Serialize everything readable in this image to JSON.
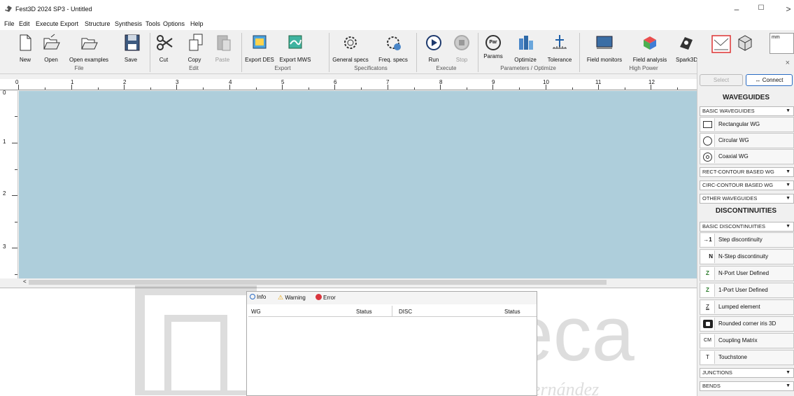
{
  "window": {
    "title": "Fest3D 2024 SP3 - Untitled"
  },
  "menu": [
    "File",
    "Edit",
    "Execute",
    "Export",
    "Structure",
    "Synthesis",
    "Tools",
    "Options",
    "Help"
  ],
  "toolbar": {
    "buttons": [
      {
        "label": "New"
      },
      {
        "label": "Open"
      },
      {
        "label": "Open examples"
      },
      {
        "label": "Save"
      },
      {
        "label": "Cut"
      },
      {
        "label": "Copy"
      },
      {
        "label": "Paste"
      },
      {
        "label": "Export DES"
      },
      {
        "label": "Export MWS"
      },
      {
        "label": "General specs"
      },
      {
        "label": "Freq. specs"
      },
      {
        "label": "Run"
      },
      {
        "label": "Stop"
      },
      {
        "label": "Params"
      },
      {
        "label": "Optimize"
      },
      {
        "label": "Tolerance"
      },
      {
        "label": "Field monitors"
      },
      {
        "label": "Field analysis"
      },
      {
        "label": "Spark3D"
      }
    ],
    "groups": [
      "File",
      "Edit",
      "Export",
      "Specificatons",
      "Execute",
      "Parameters / Optimize",
      "High Power"
    ],
    "params_icon_text": "Par",
    "unit": "mm"
  },
  "ruler": {
    "top": [
      "0",
      "1",
      "2",
      "3",
      "4",
      "5",
      "6",
      "7",
      "8",
      "9",
      "10",
      "11",
      "12"
    ],
    "left": [
      "0",
      "1",
      "2",
      "3"
    ]
  },
  "messages": {
    "tabs": [
      "Info",
      "Warning",
      "Error"
    ],
    "columns": [
      "WG",
      "Status",
      "DISC",
      "Status"
    ]
  },
  "sidepanel": {
    "select_label": "Select",
    "connect_label": "Connect",
    "waveguides_heading": "WAVEGUIDES",
    "discontinuities_heading": "DISCONTINUITIES",
    "cat_basic_wg": "BASIC WAVEGUIDES",
    "wg_items": [
      "Rectangular WG",
      "Circular WG",
      "Coaxial WG"
    ],
    "cat_rect": "RECT-CONTOUR BASED WG",
    "cat_circ": "CIRC-CONTOUR BASED WG",
    "cat_other": "OTHER WAVEGUIDES",
    "cat_basic_disc": "BASIC DISCONTINUITIES",
    "disc_items": [
      "Step discontinuity",
      "N-Step discontinuity",
      "N-Port User Defined",
      "1-Port User Defined",
      "Lumped element",
      "Rounded corner iris 3D",
      "Coupling Matrix",
      "Touchstone"
    ],
    "disc_icon_texts": [
      "→1",
      "N",
      "Z",
      "Z",
      "Z",
      "",
      "CM",
      "T"
    ],
    "cat_junctions": "JUNCTIONS",
    "cat_bends": "BENDS"
  },
  "watermark": {
    "line1": "Biblioteca",
    "line2": "UNIVERSITAS Miguel Hernández"
  },
  "colors": {
    "canvas": "#aecedb",
    "accent": "#1e73c8"
  }
}
